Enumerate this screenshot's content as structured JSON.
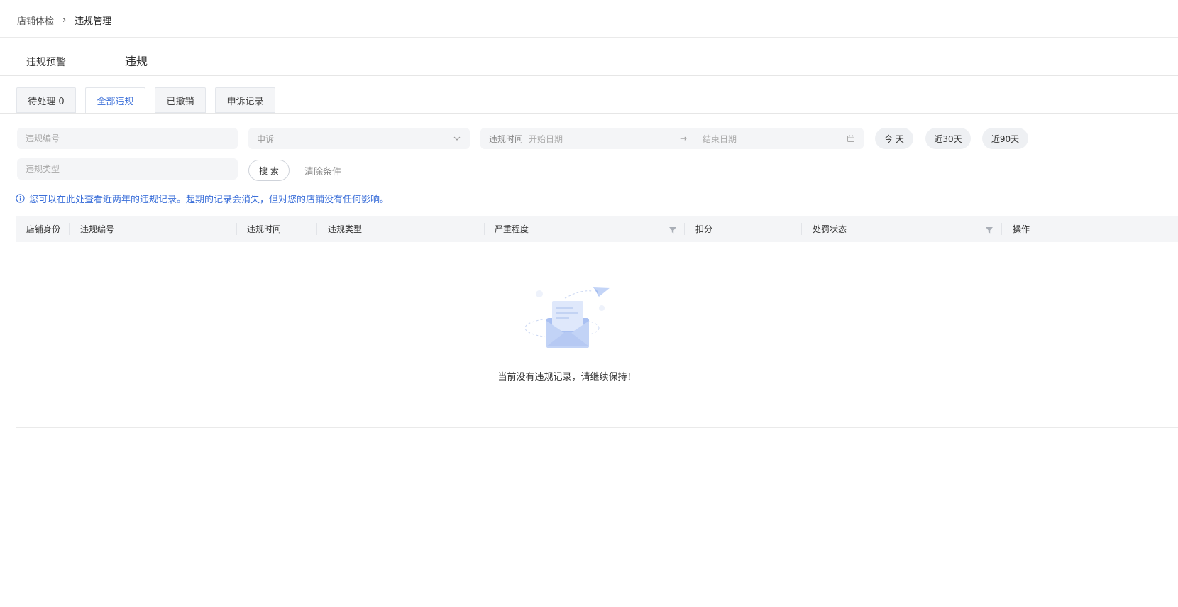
{
  "breadcrumb": {
    "root": "店铺体检",
    "separator": "›",
    "current": "违规管理"
  },
  "main_tabs": [
    {
      "label": "违规预警",
      "active": false
    },
    {
      "label": "违规",
      "active": true
    }
  ],
  "sub_tabs": [
    {
      "label": "待处理 0",
      "active": false
    },
    {
      "label": "全部违规",
      "active": true
    },
    {
      "label": "已撤销",
      "active": false
    },
    {
      "label": "申诉记录",
      "active": false
    }
  ],
  "filters": {
    "violation_no_placeholder": "违规编号",
    "appeal_select_value": "申诉",
    "date_label": "违规时间",
    "start_date_placeholder": "开始日期",
    "end_date_placeholder": "结束日期",
    "violation_type_placeholder": "违规类型",
    "quick_today": "今 天",
    "quick_30": "近30天",
    "quick_90": "近90天",
    "search_button": "搜 索",
    "clear_link": "清除条件"
  },
  "notice": "您可以在此处查看近两年的违规记录。超期的记录会消失，但对您的店铺没有任何影响。",
  "table": {
    "columns": [
      "店铺身份",
      "违规编号",
      "违规时间",
      "违规类型",
      "严重程度",
      "扣分",
      "处罚状态",
      "操作"
    ],
    "rows": [],
    "empty_text": "当前没有违规记录，请继续保持！"
  },
  "colors": {
    "accent": "#3b6fd9",
    "field_bg": "#f4f5f7",
    "header_bg": "#f4f5f7"
  },
  "icons": {
    "breadcrumb_separator": "chevron-right-icon",
    "select": "chevron-down-icon",
    "date": "calendar-icon",
    "notice": "info-icon",
    "column_filter": "filter-icon",
    "empty_state": "empty-envelope-illustration"
  }
}
